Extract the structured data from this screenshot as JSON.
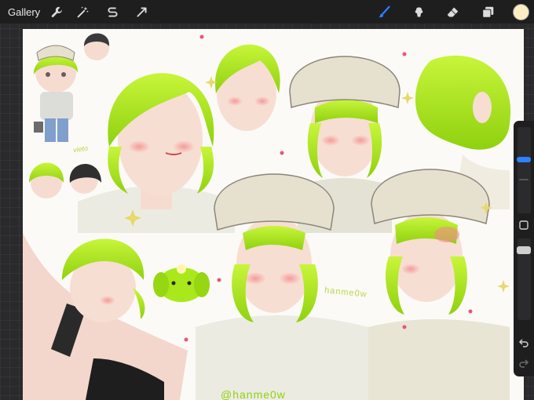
{
  "toolbar": {
    "gallery_label": "Gallery",
    "left_tools": [
      "wrench-icon",
      "magic-wand-icon",
      "selection-s-icon",
      "transform-arrow-icon"
    ],
    "right_tools": [
      "brush-icon",
      "smudge-icon",
      "eraser-icon",
      "layers-icon"
    ],
    "active_tool": "brush-icon",
    "active_color": "#fbeec4",
    "accent_color": "#2f80ff"
  },
  "canvas": {
    "hair_color": "#b3ec1a",
    "skin_color": "#f6dcd0",
    "beanie_color": "#e6e1cf",
    "signature_text": "@hanme0w",
    "side_signature_text": "hanme0w",
    "doodle_text": "vieto"
  },
  "sidebar": {
    "brush_size_level": 0.22,
    "opacity_level": 0.35
  }
}
